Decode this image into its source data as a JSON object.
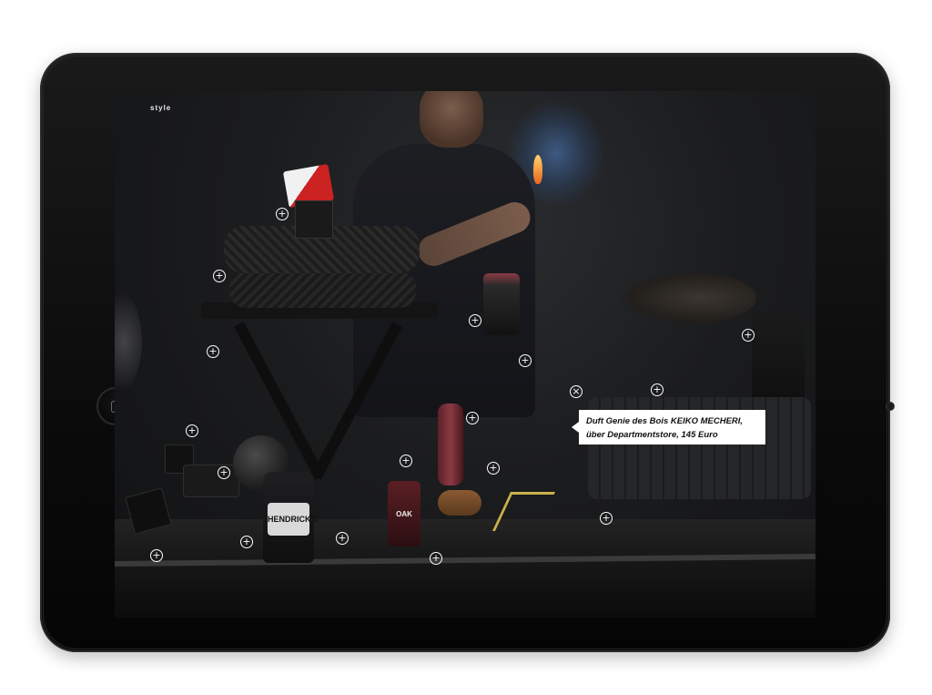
{
  "magazine": {
    "section_label": "style"
  },
  "tooltip": {
    "line1": "Duft Genie des Bois KEIKO MECHERI,",
    "line2": "über Departmentstore, 145 Euro"
  },
  "gin_label": "HENDRICK'S",
  "oak_label": "OAK",
  "hotspots": [
    {
      "symbol": "+"
    },
    {
      "symbol": "+"
    },
    {
      "symbol": "+"
    },
    {
      "symbol": "+"
    },
    {
      "symbol": "+"
    },
    {
      "symbol": "+"
    },
    {
      "symbol": "+"
    },
    {
      "symbol": "×"
    },
    {
      "symbol": "+"
    },
    {
      "symbol": "+"
    },
    {
      "symbol": "+"
    },
    {
      "symbol": "+"
    },
    {
      "symbol": "+"
    },
    {
      "symbol": "+"
    },
    {
      "symbol": "+"
    },
    {
      "symbol": "+"
    },
    {
      "symbol": "+"
    },
    {
      "symbol": "+"
    },
    {
      "symbol": "+"
    }
  ],
  "icons": {
    "home_button": "home-square-icon",
    "hotspot": "plus-circle-icon",
    "close_hotspot": "close-circle-icon"
  }
}
